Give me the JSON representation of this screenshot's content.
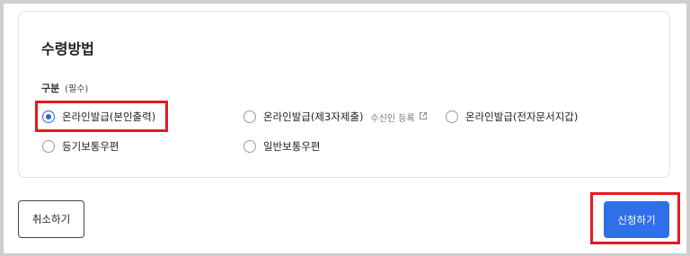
{
  "section": {
    "title": "수령방법",
    "group_label": "구분",
    "group_required": "(필수)"
  },
  "options": [
    {
      "label": "온라인발급(본인출력)",
      "checked": true
    },
    {
      "label": "온라인발급(제3자제출)",
      "checked": false,
      "sub_link": "수신인 등록"
    },
    {
      "label": "온라인발급(전자문서지갑)",
      "checked": false
    },
    {
      "label": "등기보통우편",
      "checked": false
    },
    {
      "label": "일반보통우편",
      "checked": false
    }
  ],
  "buttons": {
    "cancel": "취소하기",
    "submit": "신청하기"
  },
  "colors": {
    "accent": "#2f6fe9",
    "highlight": "#e5191d"
  }
}
